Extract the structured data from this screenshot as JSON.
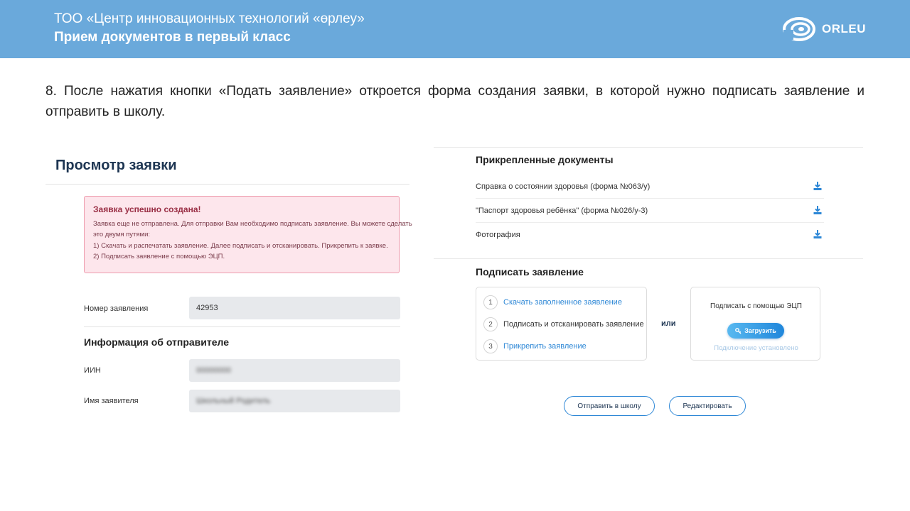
{
  "header": {
    "org": "ТОО «Центр инновационных технологий «өрлеу»",
    "subtitle": "Прием документов в первый класс",
    "logo_text": "ORLEU",
    "color": "#6aa9db"
  },
  "intro": "8. После нажатия кнопки «Подать заявление» откроется форма создания заявки, в которой нужно подписать заявление и отправить в школу.",
  "view": {
    "title": "Просмотр заявки",
    "alert": {
      "heading": "Заявка успешно создана!",
      "lines": [
        "Заявка еще не отправлена. Для отправки Вам необходимо подписать заявление. Вы можете сделать",
        "это двумя путями:",
        "1) Скачать и распечатать заявление. Далее подписать и отсканировать. Прикрепить к заявке.",
        "2) Подписать заявление с помощью ЭЦП."
      ]
    },
    "app_number_label": "Номер заявления",
    "app_number_value": "42953",
    "sender_title": "Информация об отправителе",
    "iin_label": "ИИН",
    "iin_value": "00000000",
    "name_label": "Имя заявителя",
    "name_value": "Школьный Родитель"
  },
  "documents": {
    "title": "Прикрепленные документы",
    "items": [
      {
        "name": "Справка о состоянии здоровья (форма №063/у)",
        "icon": "download-icon"
      },
      {
        "name": "\"Паспорт здоровья ребёнка\" (форма №026/у-3)",
        "icon": "download-icon"
      },
      {
        "name": "Фотография",
        "icon": "download-icon"
      }
    ]
  },
  "sign": {
    "title": "Подписать заявление",
    "steps": [
      {
        "num": "1",
        "label": "Скачать заполненное заявление",
        "style": "link"
      },
      {
        "num": "2",
        "label": "Подписать и отсканировать заявление",
        "style": "dark"
      },
      {
        "num": "3",
        "label": "Прикрепить заявление",
        "style": "link"
      }
    ],
    "or": "или",
    "ecp_title": "Подписать с помощью ЭЦП",
    "ecp_button": "Загрузить",
    "ecp_status": "Подключение установлено"
  },
  "actions": {
    "send": "Отправить в школу",
    "edit": "Редактировать"
  },
  "accent": "#2d87d6"
}
